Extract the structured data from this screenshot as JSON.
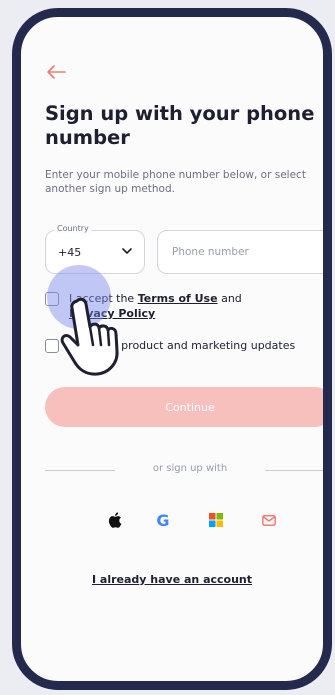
{
  "header": {
    "back_icon": "arrow-left-icon",
    "title": "Sign up with your phone number",
    "subtitle": "Enter your mobile phone number below, or select another sign up method."
  },
  "form": {
    "country_label": "Country",
    "country_value": "+45",
    "phone_placeholder": "Phone number",
    "terms": {
      "prefix": "I accept the ",
      "terms_link": "Terms of Use",
      "middle": " and ",
      "privacy_link": "Privacy Policy"
    },
    "updates_label": "Send me product and marketing updates",
    "continue_label": "Continue"
  },
  "social": {
    "divider_label": "or sign up with",
    "providers": [
      "apple-icon",
      "google-icon",
      "microsoft-icon",
      "mail-icon"
    ],
    "google_glyph": "G"
  },
  "footer": {
    "login_link": "I already have an account"
  },
  "colors": {
    "accent": "#f07c6f",
    "continue_disabled": "#f7c0bd",
    "frame": "#232a4e",
    "cursor_halo": "#7887eb"
  }
}
